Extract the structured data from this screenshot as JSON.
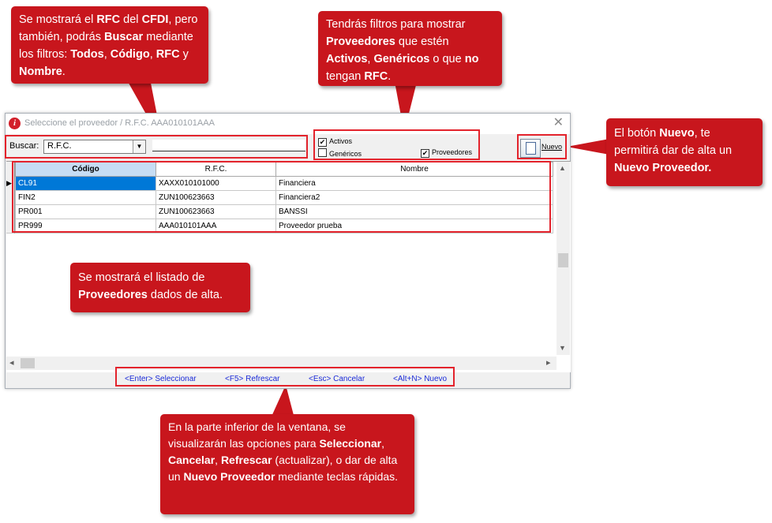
{
  "window": {
    "title": "Seleccione el proveedor / R.F.C. AAA010101AAA",
    "close_glyph": "✕"
  },
  "toolbar": {
    "buscar_label": "Buscar:",
    "search_by_value": "R.F.C.",
    "search_text": "",
    "filters": {
      "activos": {
        "label": "Activos",
        "checked": true
      },
      "genericos": {
        "label": "Genéricos",
        "checked": false
      },
      "proveedores": {
        "label": "Proveedores",
        "checked": true
      }
    },
    "nuevo_label": "Nuevo"
  },
  "grid": {
    "columns": [
      "Código",
      "R.F.C.",
      "Nombre"
    ],
    "rows": [
      {
        "codigo": "CL91",
        "rfc": "XAXX010101000",
        "nombre": "Financiera"
      },
      {
        "codigo": "FIN2",
        "rfc": "ZUN100623663",
        "nombre": "Financiera2"
      },
      {
        "codigo": "PR001",
        "rfc": "ZUN100623663",
        "nombre": "BANSSI"
      },
      {
        "codigo": "PR999",
        "rfc": "AAA010101AAA",
        "nombre": "Proveedor prueba"
      }
    ]
  },
  "footer": {
    "seleccionar": "<Enter> Seleccionar",
    "refrescar": "<F5> Refrescar",
    "cancelar": "<Esc> Cancelar",
    "nuevo": "<Alt+N> Nuevo"
  },
  "callouts": {
    "rfc": [
      "Se mostrará el ",
      "RFC",
      " del ",
      "CFDI",
      ", pero también, podrás ",
      "Buscar",
      " mediante los filtros: ",
      "Todos",
      ", ",
      "Código",
      ", ",
      "RFC",
      " y ",
      "Nombre",
      "."
    ],
    "filtros": [
      "Tendrás filtros para mostrar ",
      "Proveedores",
      " que estén ",
      "Activos",
      ", ",
      "Genéricos",
      " o que ",
      "no",
      " tengan ",
      "RFC",
      "."
    ],
    "nuevo": [
      "El botón ",
      "Nuevo",
      ", te permitirá dar de alta un ",
      "Nuevo Proveedor."
    ],
    "listado": [
      "Se mostrará el listado de ",
      "Proveedores",
      " dados de alta."
    ],
    "inferior": [
      "En la parte inferior de la ventana, se visualizarán las opciones para ",
      "Seleccionar",
      ", ",
      "Cancelar",
      ", ",
      "Refrescar",
      " (actualizar), o dar de alta un ",
      "Nuevo Proveedor",
      " mediante teclas rápidas."
    ]
  },
  "colors": {
    "callout_bg": "#c8161d",
    "highlight_border": "#e3232c",
    "footer_link": "#1a2ad8",
    "selected_row": "#0078d7"
  }
}
